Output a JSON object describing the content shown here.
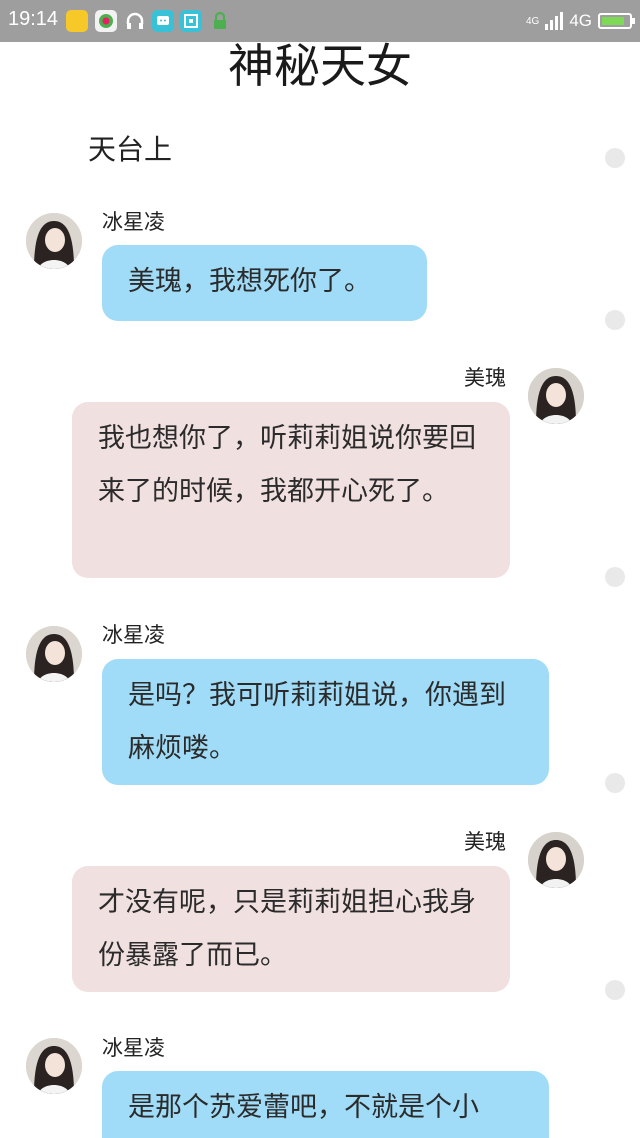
{
  "status_bar": {
    "time": "19:14",
    "network": "4G",
    "signal_small": "4G",
    "battery_color": "#7ed957"
  },
  "chapter": {
    "title": "神秘天女",
    "scene": "天台上"
  },
  "messages": [
    {
      "speaker": "冰星凌",
      "side": "left",
      "color": "#a0dcf7",
      "text": "美瑰，我想死你了。"
    },
    {
      "speaker": "美瑰",
      "side": "right",
      "color": "#f1e0e0",
      "text": "我也想你了，听莉莉姐说你要回来了的时候，我都开心死了。"
    },
    {
      "speaker": "冰星凌",
      "side": "left",
      "color": "#a0dcf7",
      "text": "是吗？我可听莉莉姐说，你遇到麻烦喽。"
    },
    {
      "speaker": "美瑰",
      "side": "right",
      "color": "#f1e0e0",
      "text": "才没有呢，只是莉莉姐担心我身份暴露了而已。"
    },
    {
      "speaker": "冰星凌",
      "side": "left",
      "color": "#a0dcf7",
      "text": "是那个苏爱蕾吧，不就是个小"
    }
  ]
}
